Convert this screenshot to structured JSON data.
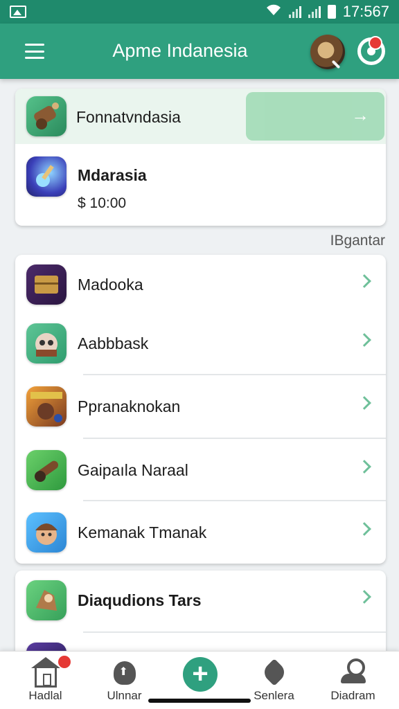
{
  "status_bar": {
    "time": "17:567",
    "icons": [
      "image-icon",
      "wifi-icon",
      "signal-icon",
      "signal-icon",
      "battery-icon"
    ]
  },
  "app_bar": {
    "title": "Apme Indanesia",
    "icons": [
      "menu-icon",
      "search-avatar",
      "chat-icon"
    ],
    "accent": "#2fa07f"
  },
  "featured": {
    "top_item": {
      "label": "Fonnatvndasia",
      "icon": "game-icon-cannon"
    },
    "main_item": {
      "label": "Mdarasia",
      "price": "$ 10:00",
      "icon": "game-icon-potion"
    }
  },
  "section_link": "IBgantar",
  "list": [
    {
      "label": "Madooka",
      "icon": "game-icon-chest"
    },
    {
      "label": "Aabbbask",
      "icon": "game-icon-creature"
    },
    {
      "label": "Ppranaknokan",
      "icon": "game-icon-battle"
    },
    {
      "label": "Gaipaıla Naraal",
      "icon": "game-icon-cannon-green"
    },
    {
      "label": "Kemanak Tmanak",
      "icon": "game-icon-hero"
    }
  ],
  "list2": [
    {
      "label": "Diaqudions Tars",
      "icon": "game-icon-warrior"
    }
  ],
  "bottom_nav": {
    "items": [
      {
        "label": "Hadlal",
        "icon": "home-icon"
      },
      {
        "label": "Ulnnar",
        "icon": "shield-icon"
      },
      {
        "label": "",
        "icon": "add-icon"
      },
      {
        "label": "Senlera",
        "icon": "heart-icon"
      },
      {
        "label": "Diadram",
        "icon": "user-icon"
      }
    ]
  }
}
